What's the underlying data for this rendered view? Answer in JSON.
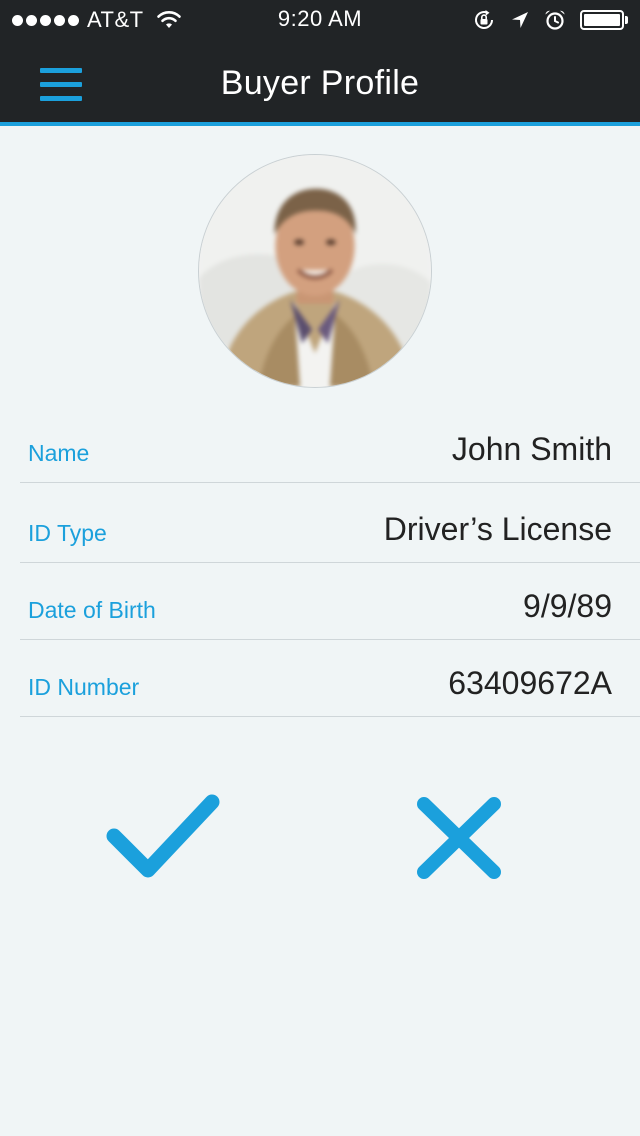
{
  "status_bar": {
    "carrier": "AT&T",
    "time": "9:20 AM",
    "signal_icon": "signal-dots-icon",
    "wifi_icon": "wifi-icon",
    "rotation_lock_icon": "rotation-lock-icon",
    "location_icon": "location-arrow-icon",
    "alarm_icon": "alarm-clock-icon",
    "battery_icon": "battery-icon"
  },
  "nav": {
    "title": "Buyer Profile",
    "menu_icon": "hamburger-menu-icon"
  },
  "profile": {
    "avatar": "profile-photo"
  },
  "fields": [
    {
      "label": "Name",
      "value": "John Smith"
    },
    {
      "label": "ID Type",
      "value": "Driver’s License"
    },
    {
      "label": "Date of Birth",
      "value": "9/9/89"
    },
    {
      "label": "ID Number",
      "value": "63409672A"
    }
  ],
  "actions": {
    "confirm_icon": "checkmark-icon",
    "cancel_icon": "close-icon"
  },
  "colors": {
    "accent": "#1ba0dc",
    "bar_background": "#212426",
    "page_background": "#f0f5f6",
    "value_text": "#222222"
  }
}
